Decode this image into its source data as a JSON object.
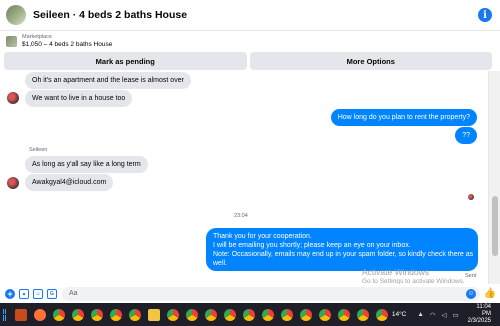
{
  "header": {
    "title": "Seileen · 4 beds 2 baths House"
  },
  "listing": {
    "source": "Marketplace",
    "price_title": "$1,050 – 4 beds 2 baths House"
  },
  "actions": {
    "mark_pending": "Mark as pending",
    "more_options": "More Options"
  },
  "messages": {
    "in1": "Oh it's an apartment and the lease is almost over",
    "in2": "We want to live in a house too",
    "out1": "How long do you plan to rent the property?",
    "out2": "??",
    "sender": "Seileen",
    "in3": "As long as y'all say like a long term",
    "in4": "Awakgyal4@icloud.com",
    "timestamp": "23:04",
    "out3": [
      "Thank you for your cooperation.",
      "I will be emailing you shortly; please keep an eye on your inbox.",
      "Note: Occasionally, emails may end up in your spam folder, so kindly check there as",
      "well."
    ],
    "status": "Sent"
  },
  "watermark": {
    "line1": "Activate Windows",
    "line2": "Go to Settings to activate Windows."
  },
  "composer": {
    "placeholder": "Aa"
  },
  "taskbar": {
    "apps": [
      {
        "name": "pc-icon",
        "color": "#c84b1e"
      },
      {
        "name": "firefox-icon",
        "color": "#ff7139"
      },
      {
        "name": "chrome-icon",
        "color": "#e74c3c"
      },
      {
        "name": "chrome-icon",
        "color": "#34a853"
      },
      {
        "name": "chrome-icon",
        "color": "#fbbc05"
      },
      {
        "name": "chrome-icon",
        "color": "#4285f4"
      },
      {
        "name": "chrome-icon",
        "color": "#ea4335"
      },
      {
        "name": "file-explorer-icon",
        "color": "#f4c542"
      },
      {
        "name": "chrome-icon",
        "color": "#34a853"
      },
      {
        "name": "chrome-icon",
        "color": "#fbbc05"
      },
      {
        "name": "chrome-icon",
        "color": "#4285f4"
      },
      {
        "name": "chrome-icon",
        "color": "#ea4335"
      },
      {
        "name": "chrome-icon",
        "color": "#34a853"
      },
      {
        "name": "chrome-icon",
        "color": "#fbbc05"
      },
      {
        "name": "chrome-icon",
        "color": "#4285f4"
      },
      {
        "name": "chrome-icon",
        "color": "#ea4335"
      },
      {
        "name": "chrome-icon",
        "color": "#34a853"
      },
      {
        "name": "chrome-icon",
        "color": "#fbbc05"
      },
      {
        "name": "chrome-icon",
        "color": "#4285f4"
      },
      {
        "name": "chrome-icon",
        "color": "#ea4335"
      }
    ],
    "temperature": "14°C",
    "time": "11:04 PM",
    "date": "2/3/2025"
  },
  "colors": {
    "accent": "#0084ff",
    "brand": "#1877f2"
  }
}
